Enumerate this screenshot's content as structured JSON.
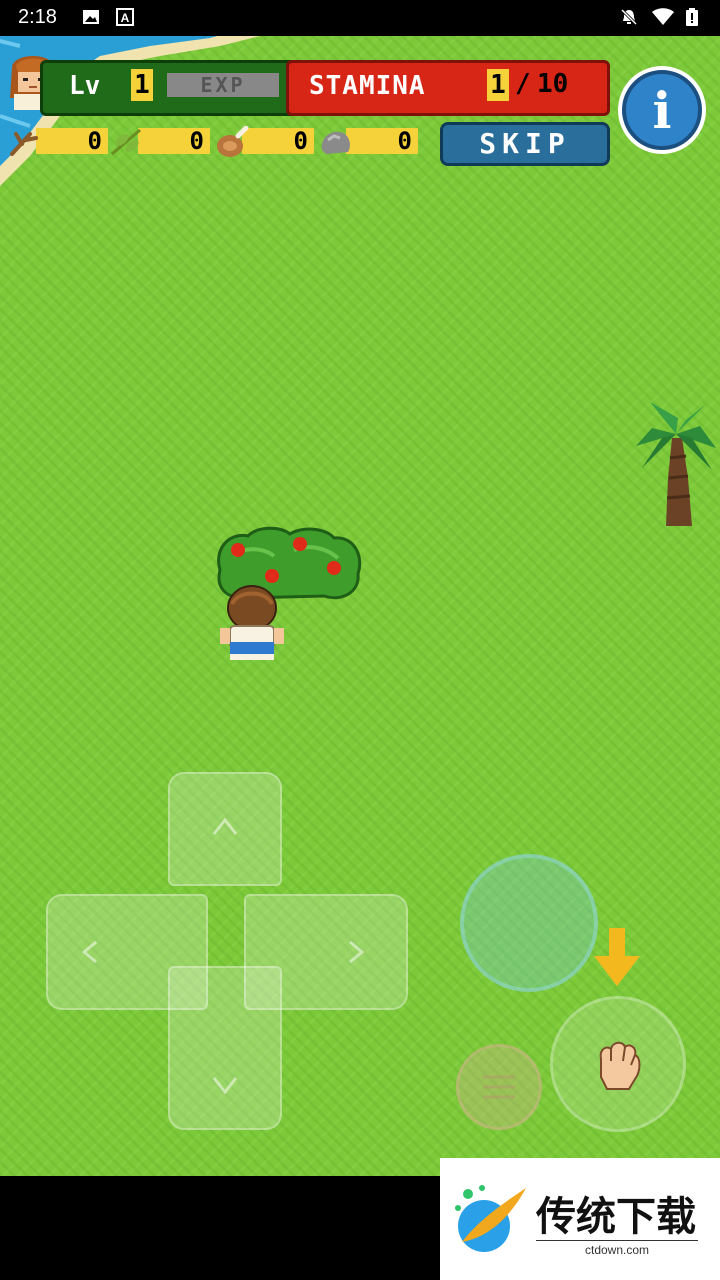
{
  "status_bar": {
    "time": "2:18",
    "left_icons": [
      "image-icon",
      "a-box-icon"
    ],
    "right_icons": [
      "notifications-off-icon",
      "wifi-icon",
      "battery-icon"
    ]
  },
  "hud": {
    "level_label": "Lv",
    "level": "1",
    "exp_label": "EXP",
    "stamina_label": "STAMINA",
    "stamina_current": "1",
    "stamina_separator": "/",
    "stamina_max": "10",
    "resources": [
      {
        "icon": "branch-icon",
        "count": "0"
      },
      {
        "icon": "leaf-icon",
        "count": "0"
      },
      {
        "icon": "meat-icon",
        "count": "0"
      },
      {
        "icon": "stone-icon",
        "count": "0"
      }
    ],
    "skip_label": "SKIP",
    "info_label": "i"
  },
  "watermark": {
    "title": "传统下载",
    "url": "ctdown.com"
  },
  "colors": {
    "grass": "#7dc93a",
    "water": "#2a9fd6",
    "stamina_red": "#d82616",
    "level_green": "#1f6b1a",
    "resource_yellow": "#f5d23a",
    "skip_blue": "#2a6f9c"
  }
}
